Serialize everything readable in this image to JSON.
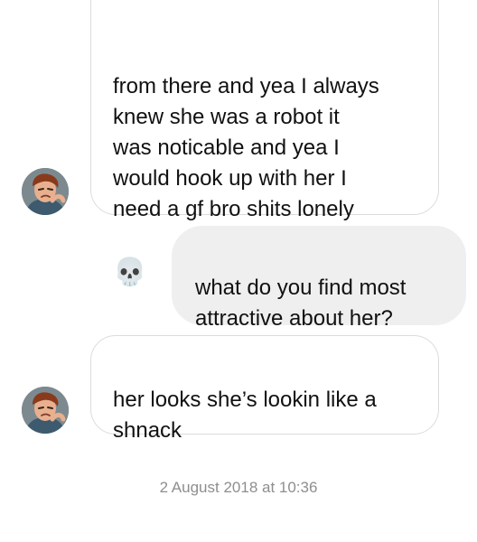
{
  "messages": [
    {
      "sender": "other",
      "text": "from there and yea I always\nknew she was a robot it\nwas noticable and yea I\nwould hook up with her I\nneed a gf bro shits lonely",
      "emoji": "💀",
      "avatar_icon": "contact-avatar"
    },
    {
      "sender": "me",
      "text": "what do you find most\nattractive about her?"
    },
    {
      "sender": "other",
      "text": "her looks she’s lookin like a\nshnack",
      "avatar_icon": "contact-avatar"
    }
  ],
  "timestamp": "2 August 2018 at 10:36",
  "colors": {
    "sent_bubble": "#efefef",
    "received_border": "#dcdcdc",
    "timestamp_text": "#8e8e8e"
  }
}
